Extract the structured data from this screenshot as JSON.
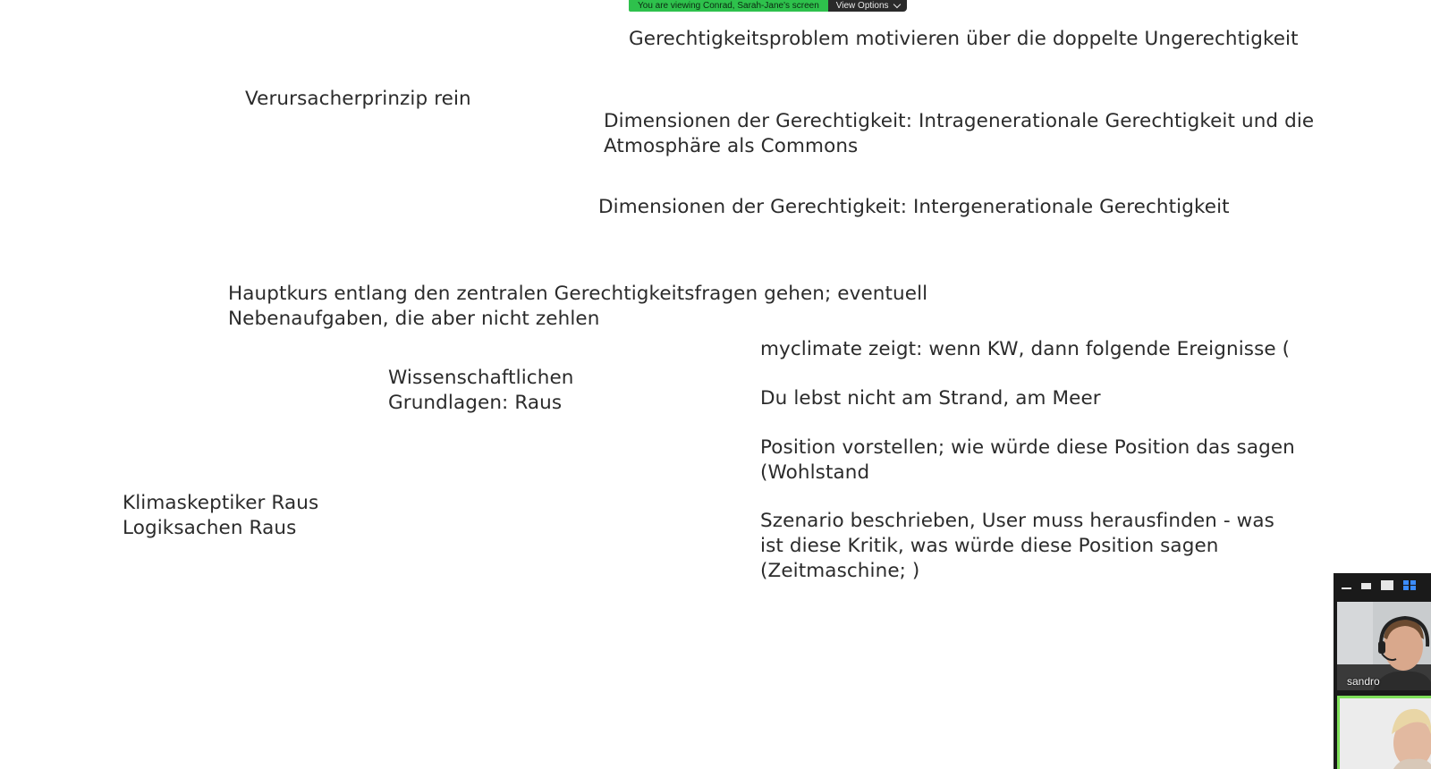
{
  "banner": {
    "viewing_text": "You are viewing Conrad, Sarah-Jane's screen",
    "view_options_label": "View Options",
    "colors": {
      "viewing_bg": "#2ec14c",
      "options_bg": "#2a2a2a"
    }
  },
  "notes": {
    "motivate": {
      "lines": [
        "Gerechtigkeitsproblem motivieren über die doppelte Ungerechtigkeit"
      ]
    },
    "polluter": {
      "lines": [
        "Verursacherprinzip rein"
      ]
    },
    "intragen": {
      "lines": [
        "Dimensionen der Gerechtigkeit: Intragenerationale Gerechtigkeit und die",
        "Atmosphäre als Commons"
      ]
    },
    "intergen": {
      "lines": [
        "Dimensionen der Gerechtigkeit: Intergenerationale Gerechtigkeit"
      ]
    },
    "maincourse": {
      "lines": [
        "Hauptkurs entlang den zentralen Gerechtigkeitsfragen gehen; eventuell",
        "Nebenaufgaben, die aber nicht zehlen"
      ]
    },
    "myclimate": {
      "lines": [
        "myclimate zeigt: wenn KW, dann folgende Ereignisse ("
      ]
    },
    "science": {
      "lines": [
        "Wissenschaftlichen",
        "Grundlagen: Raus"
      ]
    },
    "beach": {
      "lines": [
        "Du lebst nicht am Strand, am Meer"
      ]
    },
    "position": {
      "lines": [
        "Position vorstellen; wie würde diese Position das sagen",
        "(Wohlstand"
      ]
    },
    "skeptics": {
      "lines": [
        "Klimaskeptiker Raus",
        "Logiksachen Raus"
      ]
    },
    "scenario": {
      "lines": [
        "Szenario beschrieben, User muss herausfinden - was",
        "ist diese Kritik, was würde diese Position sagen",
        "(Zeitmaschine; )"
      ]
    }
  },
  "video_panel": {
    "toolbar_icons": [
      "minimize-icon",
      "small-view-icon",
      "large-view-icon",
      "gallery-view-icon"
    ],
    "participants": [
      {
        "name": "sandro"
      }
    ],
    "active_speaker_color": "#7fe05a",
    "accent": "#3b8cff"
  }
}
